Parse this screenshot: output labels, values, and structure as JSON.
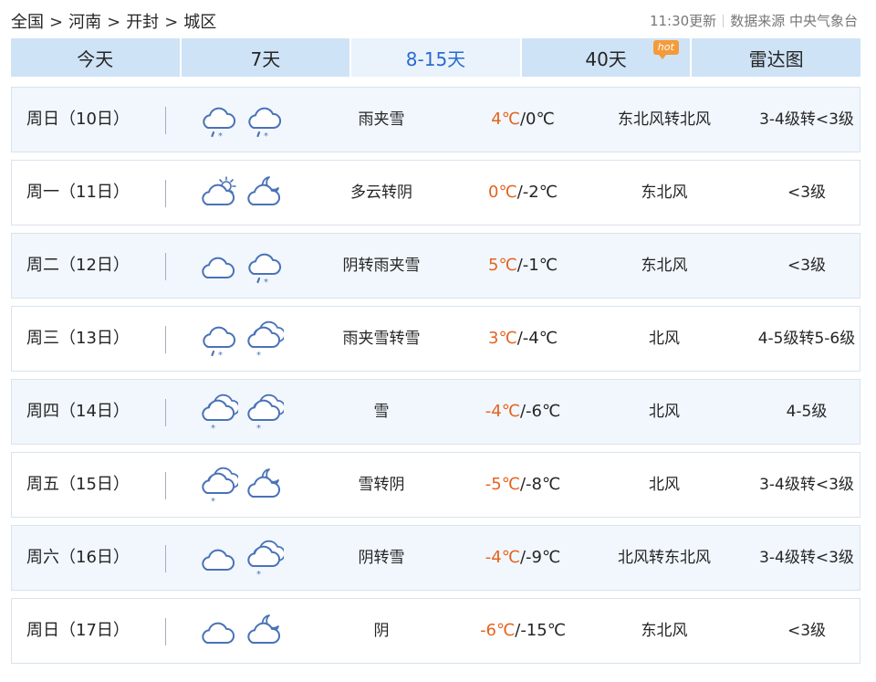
{
  "breadcrumb": [
    "全国",
    "河南",
    "开封",
    "城区"
  ],
  "breadcrumb_sep": ">",
  "update_time": "11:30更新",
  "source_label": "数据来源",
  "source_name": "中央气象台",
  "tabs": [
    {
      "label": "今天"
    },
    {
      "label": "7天"
    },
    {
      "label": "8-15天",
      "active": true
    },
    {
      "label": "40天",
      "badge": "hot"
    },
    {
      "label": "雷达图"
    }
  ],
  "colors": {
    "tab_bg": "#cfe3f6",
    "tab_active_text": "#2a6ad0",
    "high_temp": "#e5631f",
    "badge": "#f49b3a",
    "icon": "#4a72b8"
  },
  "days": [
    {
      "day": "周日（10日）",
      "icons": [
        "rain-snow",
        "rain-snow"
      ],
      "desc": "雨夹雪",
      "high": "4℃",
      "low": "0℃",
      "wind": "东北风转北风",
      "level": "3-4级转<3级"
    },
    {
      "day": "周一（11日）",
      "icons": [
        "partly-cloudy",
        "cloudy-night"
      ],
      "desc": "多云转阴",
      "high": "0℃",
      "low": "-2℃",
      "wind": "东北风",
      "level": "<3级"
    },
    {
      "day": "周二（12日）",
      "icons": [
        "overcast",
        "rain-snow"
      ],
      "desc": "阴转雨夹雪",
      "high": "5℃",
      "low": "-1℃",
      "wind": "东北风",
      "level": "<3级"
    },
    {
      "day": "周三（13日）",
      "icons": [
        "rain-snow",
        "snow"
      ],
      "desc": "雨夹雪转雪",
      "high": "3℃",
      "low": "-4℃",
      "wind": "北风",
      "level": "4-5级转5-6级"
    },
    {
      "day": "周四（14日）",
      "icons": [
        "snow",
        "snow"
      ],
      "desc": "雪",
      "high": "-4℃",
      "low": "-6℃",
      "wind": "北风",
      "level": "4-5级"
    },
    {
      "day": "周五（15日）",
      "icons": [
        "snow",
        "cloudy-night"
      ],
      "desc": "雪转阴",
      "high": "-5℃",
      "low": "-8℃",
      "wind": "北风",
      "level": "3-4级转<3级"
    },
    {
      "day": "周六（16日）",
      "icons": [
        "overcast",
        "snow"
      ],
      "desc": "阴转雪",
      "high": "-4℃",
      "low": "-9℃",
      "wind": "北风转东北风",
      "level": "3-4级转<3级"
    },
    {
      "day": "周日（17日）",
      "icons": [
        "overcast",
        "cloudy-night"
      ],
      "desc": "阴",
      "high": "-6℃",
      "low": "-15℃",
      "wind": "东北风",
      "level": "<3级"
    }
  ]
}
